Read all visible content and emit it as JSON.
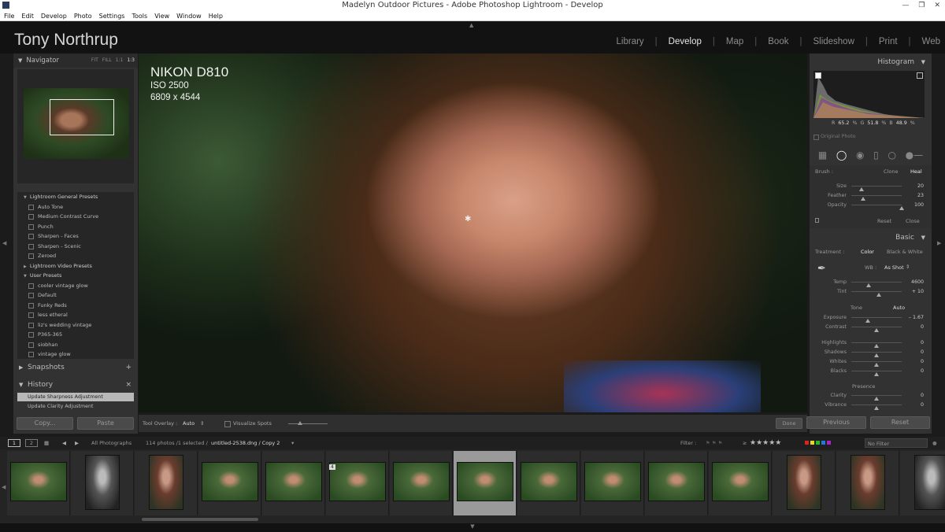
{
  "window": {
    "title": "Madelyn Outdoor Pictures - Adobe Photoshop Lightroom - Develop",
    "app_icon": "lightroom-icon",
    "controls": [
      "minimize-icon",
      "restore-icon",
      "close-icon"
    ]
  },
  "menu": [
    "File",
    "Edit",
    "Develop",
    "Photo",
    "Settings",
    "Tools",
    "View",
    "Window",
    "Help"
  ],
  "identity": "Tony Northrup",
  "modules": [
    "Library",
    "Develop",
    "Map",
    "Book",
    "Slideshow",
    "Print",
    "Web"
  ],
  "active_module": "Develop",
  "left": {
    "navigator": {
      "title": "Navigator",
      "zoom_options": [
        "FIT",
        "FILL",
        "1:1",
        "1:3"
      ],
      "selected_zoom": "1:3"
    },
    "presets": [
      {
        "kind": "folder",
        "label": "Lightroom General Presets",
        "expanded": true
      },
      {
        "kind": "item",
        "label": "Auto Tone"
      },
      {
        "kind": "item",
        "label": "Medium Contrast Curve"
      },
      {
        "kind": "item",
        "label": "Punch"
      },
      {
        "kind": "item",
        "label": "Sharpen - Faces"
      },
      {
        "kind": "item",
        "label": "Sharpen - Scenic"
      },
      {
        "kind": "item",
        "label": "Zeroed"
      },
      {
        "kind": "folder",
        "label": "Lightroom Video Presets",
        "expanded": false
      },
      {
        "kind": "folder",
        "label": "User Presets",
        "expanded": true
      },
      {
        "kind": "item",
        "label": "cooler vintage glow"
      },
      {
        "kind": "item",
        "label": "Default"
      },
      {
        "kind": "item",
        "label": "Funky Reds"
      },
      {
        "kind": "item",
        "label": "less etheral"
      },
      {
        "kind": "item",
        "label": "liz's wedding vintage"
      },
      {
        "kind": "item",
        "label": "P365-365"
      },
      {
        "kind": "item",
        "label": "siobhan"
      },
      {
        "kind": "item",
        "label": "vintage glow"
      }
    ],
    "snapshots": {
      "title": "Snapshots",
      "action": "+"
    },
    "history": {
      "title": "History",
      "action": "×",
      "items": [
        "Update Sharpness Adjustment",
        "Update Clarity Adjustment"
      ],
      "selected_index": 0
    },
    "copy_label": "Copy...",
    "paste_label": "Paste"
  },
  "photo_info": {
    "camera": "NIKON D810",
    "iso": "ISO 2500",
    "dimensions": "6809 x 4544"
  },
  "toolbar": {
    "overlay_label": "Tool Overlay :",
    "overlay_value": "Auto",
    "visualize_label": "Visualize Spots",
    "done_label": "Done"
  },
  "right": {
    "histogram": {
      "title": "Histogram",
      "r_label": "R",
      "r_value": "65.2",
      "g_label": "G",
      "g_value": "51.8",
      "b_label": "B",
      "b_value": "48.9",
      "percent": "%",
      "original_photo": "Original Photo"
    },
    "tools": [
      "crop-grid-icon",
      "spot-removal-icon",
      "red-eye-icon",
      "graduated-filter-icon",
      "radial-filter-icon",
      "adjustment-brush-icon"
    ],
    "brush": {
      "label": "Brush :",
      "mode_clone": "Clone",
      "mode_heal": "Heal",
      "sliders": [
        {
          "label": "Size",
          "value": "20",
          "level": 0.2
        },
        {
          "label": "Feather",
          "value": "23",
          "level": 0.23
        },
        {
          "label": "Opacity",
          "value": "100",
          "level": 1.0
        }
      ],
      "reset": "Reset",
      "close": "Close"
    },
    "basic": {
      "title": "Basic",
      "treatment_label": "Treatment :",
      "color": "Color",
      "bw": "Black & White",
      "wb_label": "WB :",
      "wb_value": "As Shot",
      "temp": {
        "label": "Temp",
        "value": "4600",
        "level": 0.35
      },
      "tint": {
        "label": "Tint",
        "value": "+ 10",
        "level": 0.55
      },
      "tone_label": "Tone",
      "auto_label": "Auto",
      "tone_sliders": [
        {
          "label": "Exposure",
          "value": "– 1.67",
          "level": 0.33
        },
        {
          "label": "Contrast",
          "value": "0",
          "level": 0.5
        },
        {
          "label": "Highlights",
          "value": "0",
          "level": 0.5
        },
        {
          "label": "Shadows",
          "value": "0",
          "level": 0.5
        },
        {
          "label": "Whites",
          "value": "0",
          "level": 0.5
        },
        {
          "label": "Blacks",
          "value": "0",
          "level": 0.5
        }
      ],
      "presence_label": "Presence",
      "presence_sliders": [
        {
          "label": "Clarity",
          "value": "0",
          "level": 0.5
        },
        {
          "label": "Vibrance",
          "value": "0",
          "level": 0.5
        }
      ]
    },
    "previous_label": "Previous",
    "reset_label": "Reset"
  },
  "filmstrip": {
    "screen_1": "1",
    "screen_2": "2",
    "source": "All Photographs",
    "count_text": "114 photos /1 selected /",
    "filename": "untitled-2538.dng / Copy 2",
    "filter_label": "Filter :",
    "rating_op": "≥",
    "stars": "★★★★★",
    "no_filter": "No Filter",
    "label_colors": [
      "#d22",
      "#dd2",
      "#2b2",
      "#27d",
      "#a2c"
    ],
    "selected_index": 7,
    "stack_badge": "4"
  },
  "colors": {
    "accent": "#dcdcdc",
    "panel": "#323232",
    "selected_cell": "#9a9a9a"
  }
}
